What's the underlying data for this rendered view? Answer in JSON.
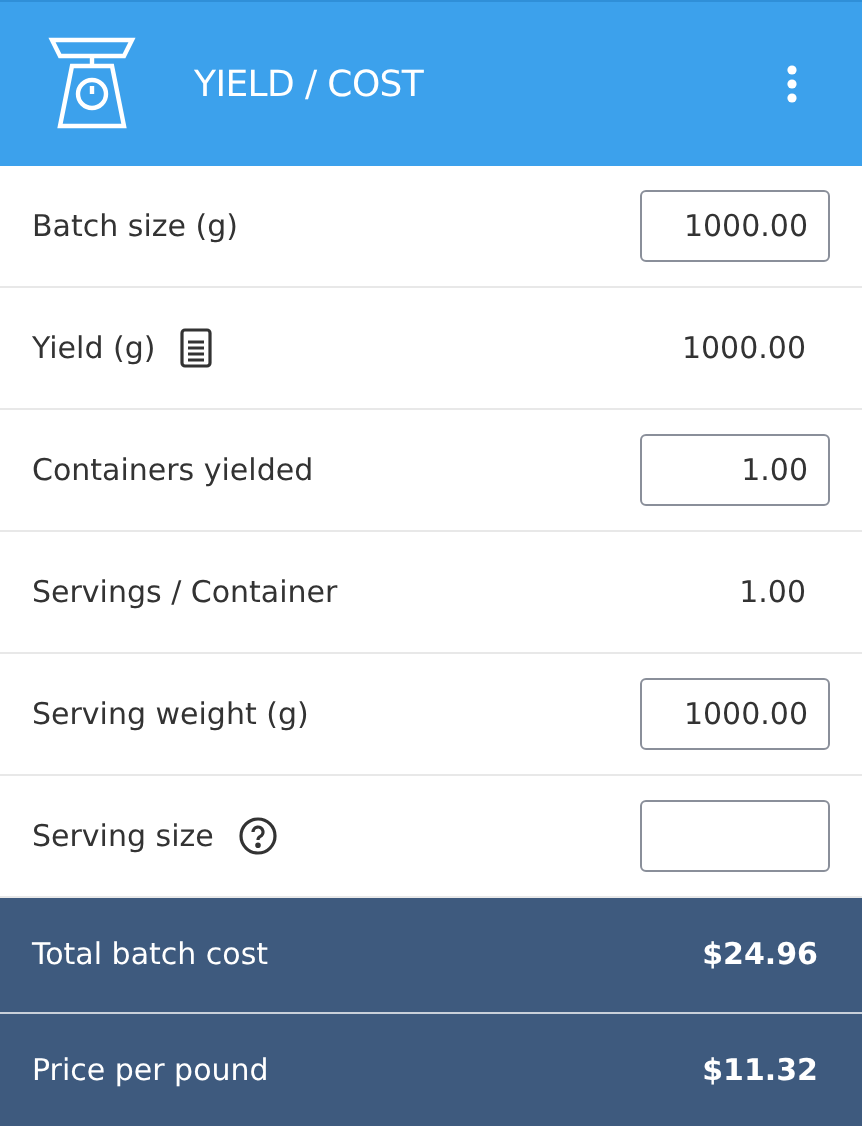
{
  "header": {
    "title": "YIELD / COST"
  },
  "rows": [
    {
      "label": "Batch size (g)",
      "kind": "input",
      "value": "1000.00"
    },
    {
      "label": "Yield (g)",
      "kind": "noted-value",
      "value": "1000.00"
    },
    {
      "label": "Containers yielded",
      "kind": "input",
      "value": "1.00"
    },
    {
      "label": "Servings / Container",
      "kind": "value",
      "value": "1.00"
    },
    {
      "label": "Serving weight (g)",
      "kind": "input",
      "value": "1000.00"
    },
    {
      "label": "Serving size",
      "kind": "help-input"
    }
  ],
  "totals": [
    {
      "label": "Total batch cost",
      "value": "$24.96"
    },
    {
      "label": "Price per pound",
      "value": "$11.32"
    }
  ]
}
